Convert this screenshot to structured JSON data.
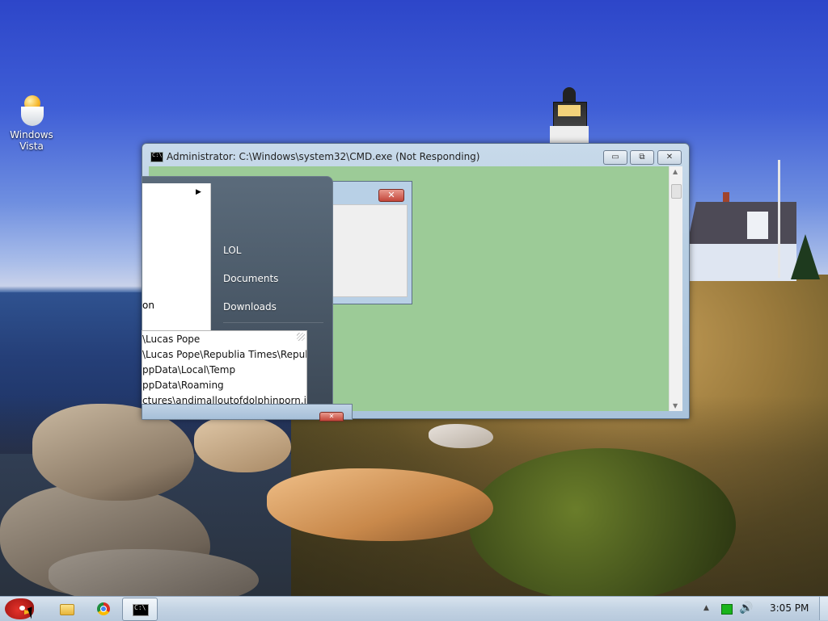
{
  "desktop": {
    "icons": [
      {
        "label_line1": "Windows",
        "label_line2": "Vista",
        "icon": "egg-icon"
      }
    ]
  },
  "cmd_window": {
    "title": "Administrator: C:\\Windows\\system32\\CMD.exe (Not Responding)",
    "minimize": "▭",
    "maximize": "⧉",
    "close": "✕",
    "body_color": "#9ccb97"
  },
  "dialog": {
    "close": "✕"
  },
  "start_menu": {
    "left_fragment": "on",
    "right_items": [
      "LOL",
      "Documents",
      "Downloads"
    ]
  },
  "path_list": {
    "items": [
      "\\Lucas Pope",
      "\\Lucas Pope\\Republia Times\\Republia",
      "ppData\\Local\\Temp",
      "ppData\\Roaming",
      "ctures\\andimalloutofdolphinporn.jpg"
    ]
  },
  "fragment_bar": {
    "close": "✕"
  },
  "taskbar": {
    "buttons": [
      {
        "name": "start-orb",
        "icon": "angry-bird-icon"
      },
      {
        "name": "explorer",
        "icon": "folder-icon"
      },
      {
        "name": "chrome",
        "icon": "chrome-icon"
      },
      {
        "name": "cmd",
        "icon": "cmd-icon",
        "active": true
      }
    ],
    "tray": {
      "overflow": "▲",
      "volume": "🔊",
      "time": "3:05 PM"
    }
  },
  "colors": {
    "cmd_background": "#9ccb97",
    "taskbar": "#c3d3e3",
    "close_button": "#c3463a"
  }
}
